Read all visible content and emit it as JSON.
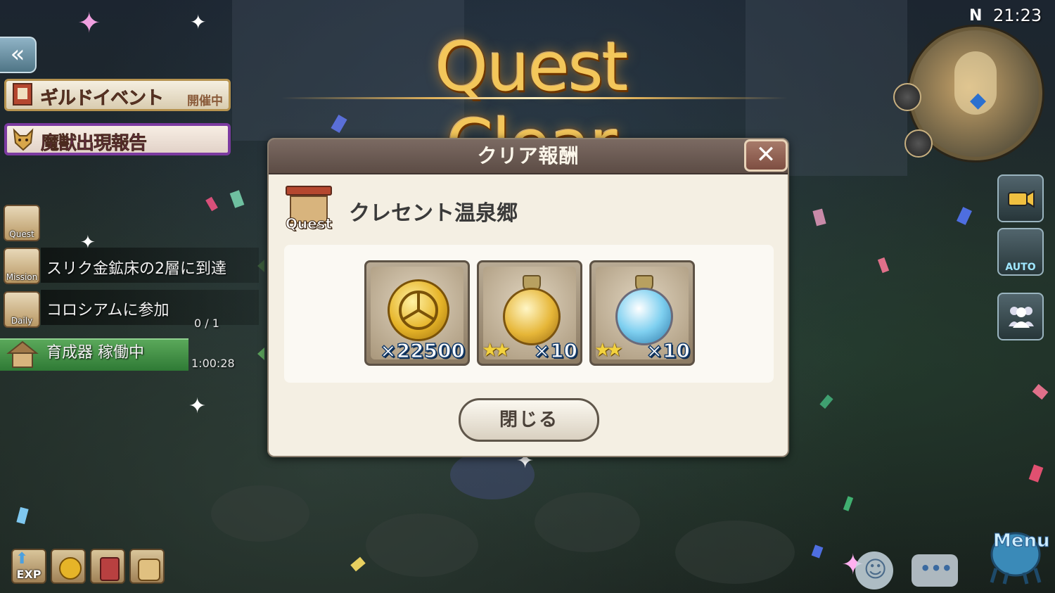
{
  "title": "Quest Clear",
  "clock": "21:23",
  "compass": "N",
  "banners": {
    "guild_event": {
      "label": "ギルドイベント",
      "status": "開催中"
    },
    "beast_report": {
      "label": "魔獣出現報告"
    }
  },
  "side_list": [
    {
      "icon_label": "Quest",
      "text": ""
    },
    {
      "icon_label": "Mission",
      "text": "スリク金鉱床の2層に到達"
    },
    {
      "icon_label": "Daily",
      "text": "コロシアムに参加",
      "count": "0 / 1"
    },
    {
      "icon_label": "",
      "text": "育成器 稼働中",
      "timer": "1:00:28"
    }
  ],
  "boost_icons": [
    "EXP",
    "",
    "",
    ""
  ],
  "right_buttons": {
    "camera": "",
    "auto": "AUTO",
    "party": ""
  },
  "dialog": {
    "title": "クリア報酬",
    "close_symbol": "✕",
    "quest_icon_label": "Quest",
    "location": "クレセント温泉郷",
    "rewards": [
      {
        "icon": "gold-coin-icon",
        "count": "×22500",
        "stars": ""
      },
      {
        "icon": "gold-orb-icon",
        "count": "×10",
        "stars": "★★"
      },
      {
        "icon": "blue-orb-icon",
        "count": "×10",
        "stars": "★★"
      }
    ],
    "close_button": "閉じる"
  },
  "menu_label": "Menu",
  "chat_symbol": "•••",
  "colors": {
    "title_gold": "#f3c65a",
    "dialog_bg": "#f4efe3",
    "header_bg": "#6b5a52",
    "beast_border": "#7c3aa0",
    "breeder_green": "#3f8a45"
  }
}
